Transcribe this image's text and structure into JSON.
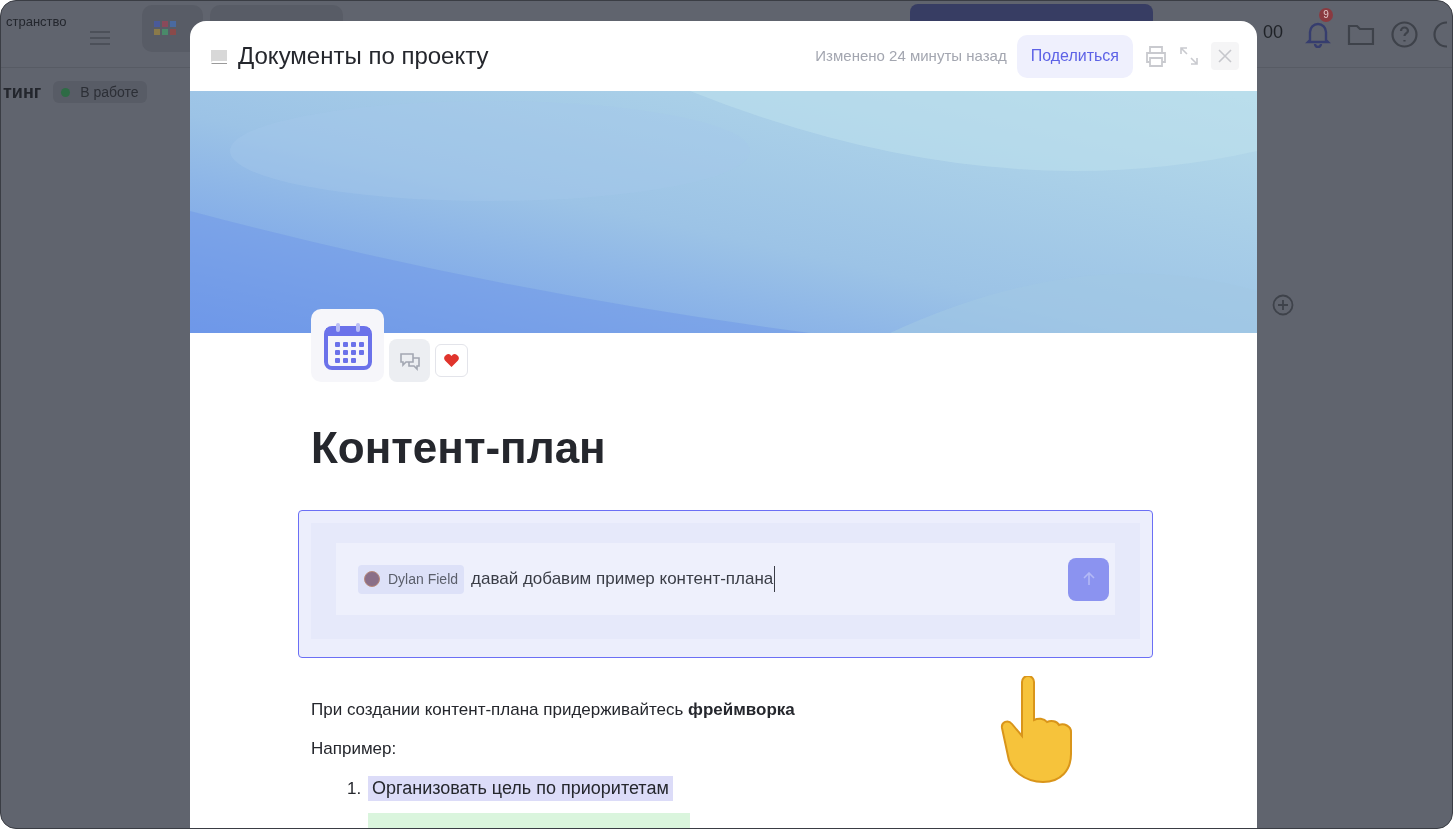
{
  "background_app": {
    "workspace_label": "странство",
    "counter": "00",
    "notification_count": "9",
    "project_title": "тинг",
    "status": {
      "label": "В работе",
      "color": "#2e6b45"
    }
  },
  "modal": {
    "title": "Документы по проекту",
    "modified": "Изменено 24 минуты назад",
    "share_button": "Поделиться"
  },
  "document": {
    "heading": "Контент-план",
    "prompt": {
      "mention": "Dylan Field",
      "value": "давай добавим пример контент-плана"
    },
    "paragraphs": [
      "При создании контент-плана придерживайтесь **фреймворка**",
      "Например:"
    ],
    "list": [
      {
        "number": "1.",
        "text": "Организовать цель по приоритетам",
        "color": "#dcdcf8"
      },
      {
        "color": "#daf5dd"
      }
    ]
  }
}
